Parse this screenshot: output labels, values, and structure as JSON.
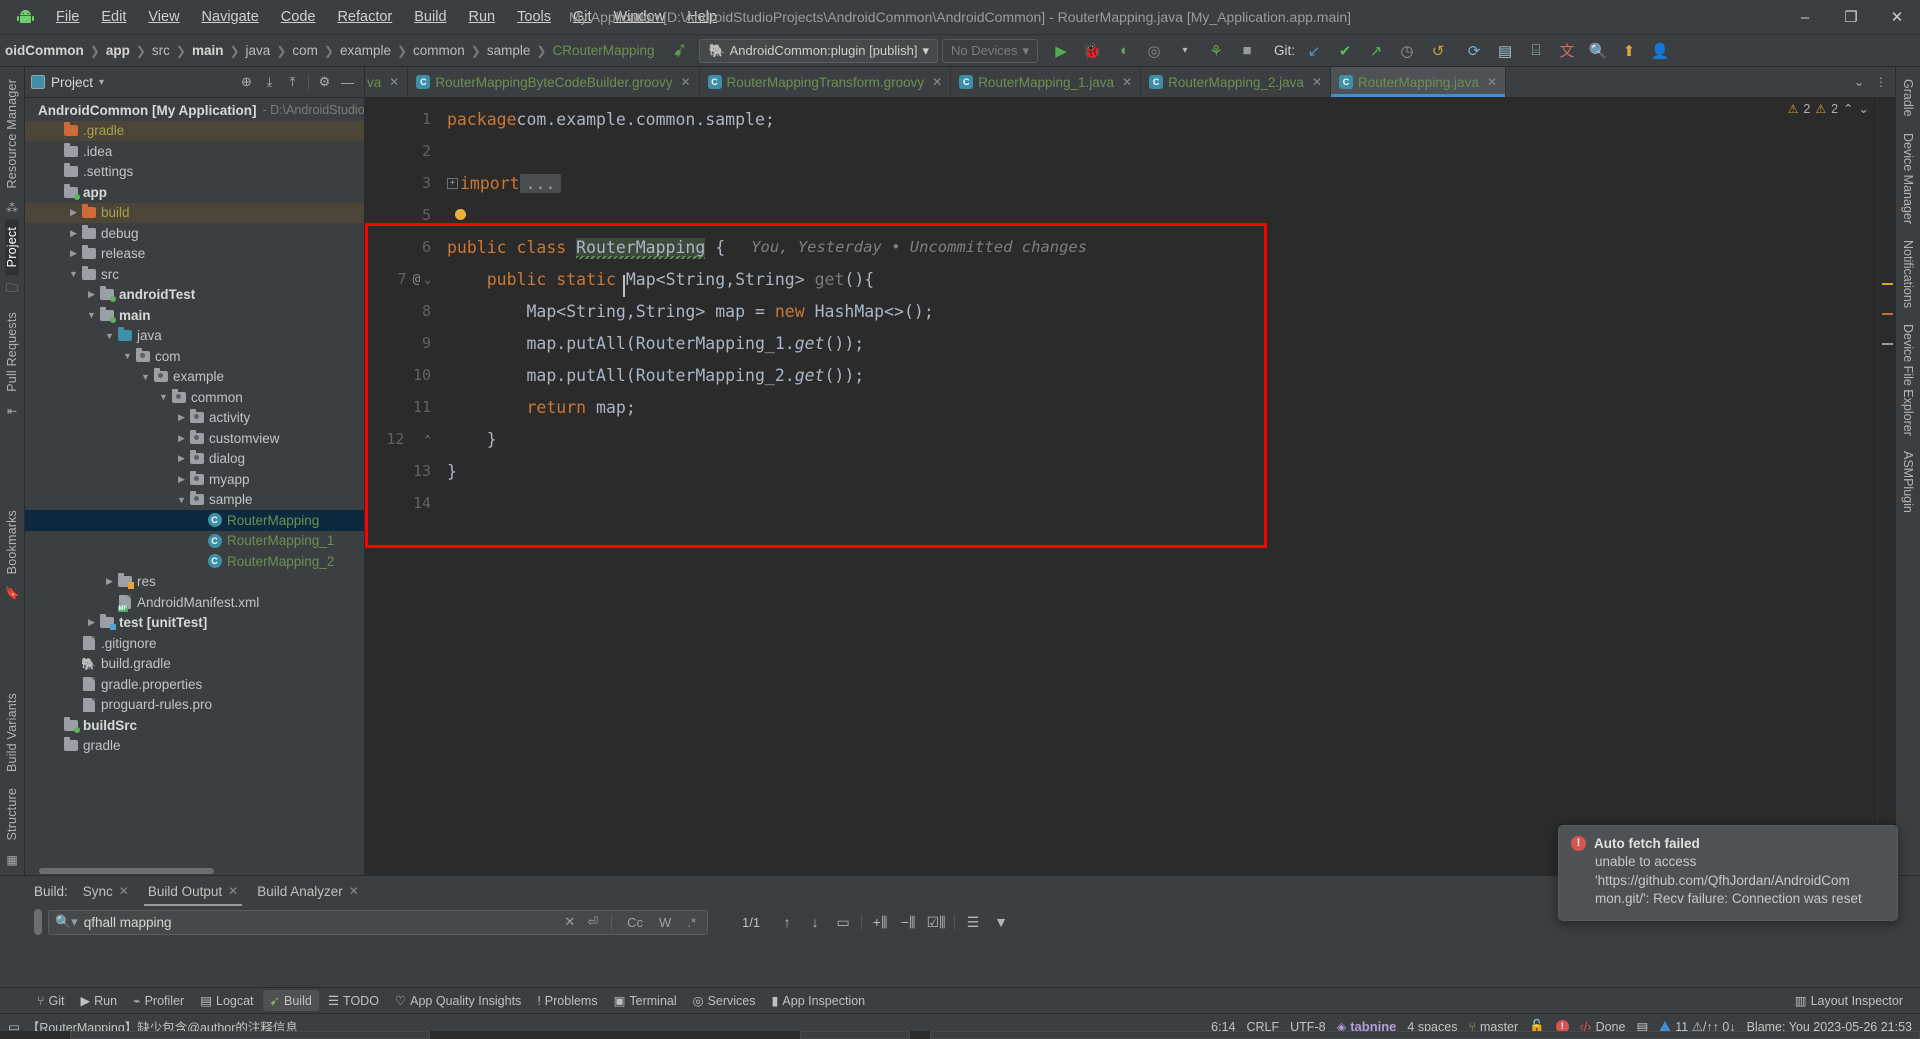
{
  "titlebar": {
    "app_icon": "android-logo-icon",
    "menu": [
      "File",
      "Edit",
      "View",
      "Navigate",
      "Code",
      "Refactor",
      "Build",
      "Run",
      "Tools",
      "Git",
      "Window",
      "Help"
    ],
    "window_title": "My Application [D:\\AndroidStudioProjects\\AndroidCommon\\AndroidCommon] - RouterMapping.java [My_Application.app.main]",
    "minimize": "–",
    "restore": "❐",
    "close": "✕"
  },
  "navbar": {
    "crumbs": [
      {
        "label": "oidCommon",
        "style": "bold"
      },
      {
        "label": "app",
        "style": "bold"
      },
      {
        "label": "src",
        "style": "normal"
      },
      {
        "label": "main",
        "style": "bold"
      },
      {
        "label": "java",
        "style": "normal"
      },
      {
        "label": "com",
        "style": "normal"
      },
      {
        "label": "example",
        "style": "normal"
      },
      {
        "label": "common",
        "style": "normal"
      },
      {
        "label": "sample",
        "style": "normal"
      },
      {
        "label": "RouterMapping",
        "style": "class"
      }
    ],
    "run_config": "AndroidCommon:plugin [publish]",
    "device_selector": "No Devices",
    "git_label": "Git:",
    "icons": [
      "run-icon",
      "debug-icon",
      "run-coverage-icon",
      "profile-icon",
      "dropdown-icon",
      "build-project-icon",
      "stop-icon",
      "git-update-icon",
      "git-commit-icon",
      "git-push-icon",
      "git-history-icon",
      "git-rollback-icon",
      "gradle-sync-icon",
      "device-manager-icon",
      "avd-icon",
      "translate-icon",
      "search-everywhere-icon",
      "notification-icon",
      "account-icon"
    ]
  },
  "left_rail": {
    "top": [
      "Resource Manager",
      "Project"
    ],
    "bottom": [
      "Pull Requests",
      "Bookmarks",
      "Build Variants",
      "Structure"
    ]
  },
  "right_rail": {
    "items": [
      "Gradle",
      "Device Manager",
      "Notifications",
      "Device File Explorer",
      "ASMPlugin"
    ]
  },
  "project_panel": {
    "title": "Project",
    "header_icons": [
      "locate-icon",
      "expand-all-icon",
      "collapse-all-icon",
      "settings-gear-icon",
      "hide-icon"
    ],
    "root": {
      "name": "AndroidCommon [My Application]",
      "path": "- D:\\AndroidStudioPr"
    },
    "tree": [
      {
        "label": ".gradle",
        "indent": 1,
        "arrow": "",
        "icon": "folder-orange",
        "style": "yellow",
        "state": "highlight"
      },
      {
        "label": ".idea",
        "indent": 1,
        "arrow": "",
        "icon": "folder",
        "style": "normal",
        "state": ""
      },
      {
        "label": ".settings",
        "indent": 1,
        "arrow": "",
        "icon": "folder",
        "style": "normal",
        "state": ""
      },
      {
        "label": "app",
        "indent": 1,
        "arrow": "",
        "icon": "folder-module",
        "style": "bold",
        "state": ""
      },
      {
        "label": "build",
        "indent": 2,
        "arrow": "▶",
        "icon": "folder-orange",
        "style": "yellow",
        "state": "highlight"
      },
      {
        "label": "debug",
        "indent": 2,
        "arrow": "▶",
        "icon": "folder",
        "style": "normal",
        "state": ""
      },
      {
        "label": "release",
        "indent": 2,
        "arrow": "▶",
        "icon": "folder",
        "style": "normal",
        "state": ""
      },
      {
        "label": "src",
        "indent": 2,
        "arrow": "▼",
        "icon": "folder",
        "style": "normal",
        "state": ""
      },
      {
        "label": "androidTest",
        "indent": 3,
        "arrow": "▶",
        "icon": "folder-module",
        "style": "bold",
        "state": ""
      },
      {
        "label": "main",
        "indent": 3,
        "arrow": "▼",
        "icon": "folder-module",
        "style": "bold",
        "state": ""
      },
      {
        "label": "java",
        "indent": 4,
        "arrow": "▼",
        "icon": "folder-blue",
        "style": "normal",
        "state": ""
      },
      {
        "label": "com",
        "indent": 5,
        "arrow": "▼",
        "icon": "package",
        "style": "normal",
        "state": ""
      },
      {
        "label": "example",
        "indent": 6,
        "arrow": "▼",
        "icon": "package",
        "style": "normal",
        "state": ""
      },
      {
        "label": "common",
        "indent": 7,
        "arrow": "▼",
        "icon": "package",
        "style": "normal",
        "state": ""
      },
      {
        "label": "activity",
        "indent": 8,
        "arrow": "▶",
        "icon": "package",
        "style": "normal",
        "state": ""
      },
      {
        "label": "customview",
        "indent": 8,
        "arrow": "▶",
        "icon": "package",
        "style": "normal",
        "state": ""
      },
      {
        "label": "dialog",
        "indent": 8,
        "arrow": "▶",
        "icon": "package",
        "style": "normal",
        "state": ""
      },
      {
        "label": "myapp",
        "indent": 8,
        "arrow": "▶",
        "icon": "package",
        "style": "normal",
        "state": ""
      },
      {
        "label": "sample",
        "indent": 8,
        "arrow": "▼",
        "icon": "package",
        "style": "normal",
        "state": ""
      },
      {
        "label": "RouterMapping",
        "indent": 9,
        "arrow": "",
        "icon": "java-class",
        "style": "green",
        "state": "selected"
      },
      {
        "label": "RouterMapping_1",
        "indent": 9,
        "arrow": "",
        "icon": "java-class",
        "style": "green",
        "state": ""
      },
      {
        "label": "RouterMapping_2",
        "indent": 9,
        "arrow": "",
        "icon": "java-class",
        "style": "green",
        "state": ""
      },
      {
        "label": "res",
        "indent": 4,
        "arrow": "▶",
        "icon": "folder-res",
        "style": "normal",
        "state": ""
      },
      {
        "label": "AndroidManifest.xml",
        "indent": 4,
        "arrow": "",
        "icon": "manifest",
        "style": "normal",
        "state": ""
      },
      {
        "label": "test [unitTest]",
        "indent": 3,
        "arrow": "▶",
        "icon": "folder-test",
        "style": "bold",
        "state": ""
      },
      {
        "label": ".gitignore",
        "indent": 2,
        "arrow": "",
        "icon": "gitignore",
        "style": "normal",
        "state": ""
      },
      {
        "label": "build.gradle",
        "indent": 2,
        "arrow": "",
        "icon": "gradle",
        "style": "normal",
        "state": ""
      },
      {
        "label": "gradle.properties",
        "indent": 2,
        "arrow": "",
        "icon": "properties",
        "style": "normal",
        "state": ""
      },
      {
        "label": "proguard-rules.pro",
        "indent": 2,
        "arrow": "",
        "icon": "file",
        "style": "normal",
        "state": ""
      },
      {
        "label": "buildSrc",
        "indent": 1,
        "arrow": "",
        "icon": "folder-module",
        "style": "bold",
        "state": ""
      },
      {
        "label": "gradle",
        "indent": 1,
        "arrow": "",
        "icon": "folder",
        "style": "normal",
        "state": ""
      }
    ]
  },
  "editor": {
    "tabs": [
      {
        "label": "va",
        "active": false,
        "truncated": true
      },
      {
        "label": "RouterMappingByteCodeBuilder.groovy",
        "active": false
      },
      {
        "label": "RouterMappingTransform.groovy",
        "active": false
      },
      {
        "label": "RouterMapping_1.java",
        "active": false
      },
      {
        "label": "RouterMapping_2.java",
        "active": false
      },
      {
        "label": "RouterMapping.java",
        "active": true
      }
    ],
    "tab_overflow": "⌄",
    "tab_menu": "⋮",
    "inspections": {
      "warn_count": "2",
      "weak_count": "2",
      "up": "⌃",
      "down": "⌄"
    },
    "line_numbers": [
      "1",
      "2",
      "3",
      "5",
      "6",
      "7",
      "8",
      "9",
      "10",
      "11",
      "12",
      "13",
      "14"
    ],
    "code_lines": [
      {
        "num": "1",
        "text": "package com.example.common.sample;"
      },
      {
        "num": "2",
        "text": ""
      },
      {
        "num": "3",
        "text": "import ..."
      },
      {
        "num": "5",
        "text": ""
      },
      {
        "num": "6",
        "text": "public class RouterMapping {",
        "hint": "You, Yesterday • Uncommitted changes"
      },
      {
        "num": "7",
        "text": "    public static Map<String,String> get(){",
        "marker": "@"
      },
      {
        "num": "8",
        "text": "        Map<String,String> map = new HashMap<>();"
      },
      {
        "num": "9",
        "text": "        map.putAll(RouterMapping_1.get());"
      },
      {
        "num": "10",
        "text": "        map.putAll(RouterMapping_2.get());"
      },
      {
        "num": "11",
        "text": "        return map;"
      },
      {
        "num": "12",
        "text": "    }"
      },
      {
        "num": "13",
        "text": "}"
      },
      {
        "num": "14",
        "text": ""
      }
    ]
  },
  "bottom_panel": {
    "label": "Build:",
    "tabs": [
      {
        "label": "Sync",
        "active": false,
        "closable": true
      },
      {
        "label": "Build Output",
        "active": true,
        "closable": true
      },
      {
        "label": "Build Analyzer",
        "active": false,
        "closable": true
      }
    ],
    "search": {
      "value": "qfhall mapping",
      "placeholder": "Search",
      "clear": "✕",
      "history": "⏎",
      "match_case": "Cc",
      "words": "W",
      "regex": ".*"
    },
    "match_count": "1/1",
    "tools": [
      "prev-match-icon",
      "next-match-icon",
      "soft-wrap-icon",
      "expand-icon",
      "collapse-icon",
      "toggle-tasks-icon",
      "tree-view-icon",
      "filter-icon"
    ]
  },
  "tool_window_bar": {
    "items": [
      {
        "label": "Git",
        "icon": "git-icon",
        "active": false
      },
      {
        "label": "Run",
        "icon": "run-icon",
        "active": false
      },
      {
        "label": "Profiler",
        "icon": "profiler-icon",
        "active": false
      },
      {
        "label": "Logcat",
        "icon": "logcat-icon",
        "active": false
      },
      {
        "label": "Build",
        "icon": "build-icon",
        "active": true
      },
      {
        "label": "TODO",
        "icon": "todo-icon",
        "active": false
      },
      {
        "label": "App Quality Insights",
        "icon": "insights-icon",
        "active": false
      },
      {
        "label": "Problems",
        "icon": "problems-icon",
        "active": false
      },
      {
        "label": "Terminal",
        "icon": "terminal-icon",
        "active": false
      },
      {
        "label": "Services",
        "icon": "services-icon",
        "active": false
      },
      {
        "label": "App Inspection",
        "icon": "app-inspection-icon",
        "active": false
      }
    ],
    "right": {
      "label": "Layout Inspector",
      "icon": "layout-inspector-icon"
    }
  },
  "status_bar": {
    "message": "【RouterMapping】缺少包含@author的注释信息",
    "caret": "6:14",
    "line_sep": "CRLF",
    "encoding": "UTF-8",
    "plugin": "tabnine",
    "indent": "4 spaces",
    "branch": "master",
    "lock": "read-write-icon",
    "errors": "!",
    "inspection": "Done",
    "warn_counts": "11 ⚠/↑↑ 0↓",
    "blame": "Blame: You 2023-05-26 21:53"
  },
  "notification": {
    "title": "Auto fetch failed",
    "lines": [
      "unable to access",
      "'https://github.com/QfhJordan/AndroidCom",
      "mon.git/': Recv failure: Connection was reset"
    ]
  }
}
